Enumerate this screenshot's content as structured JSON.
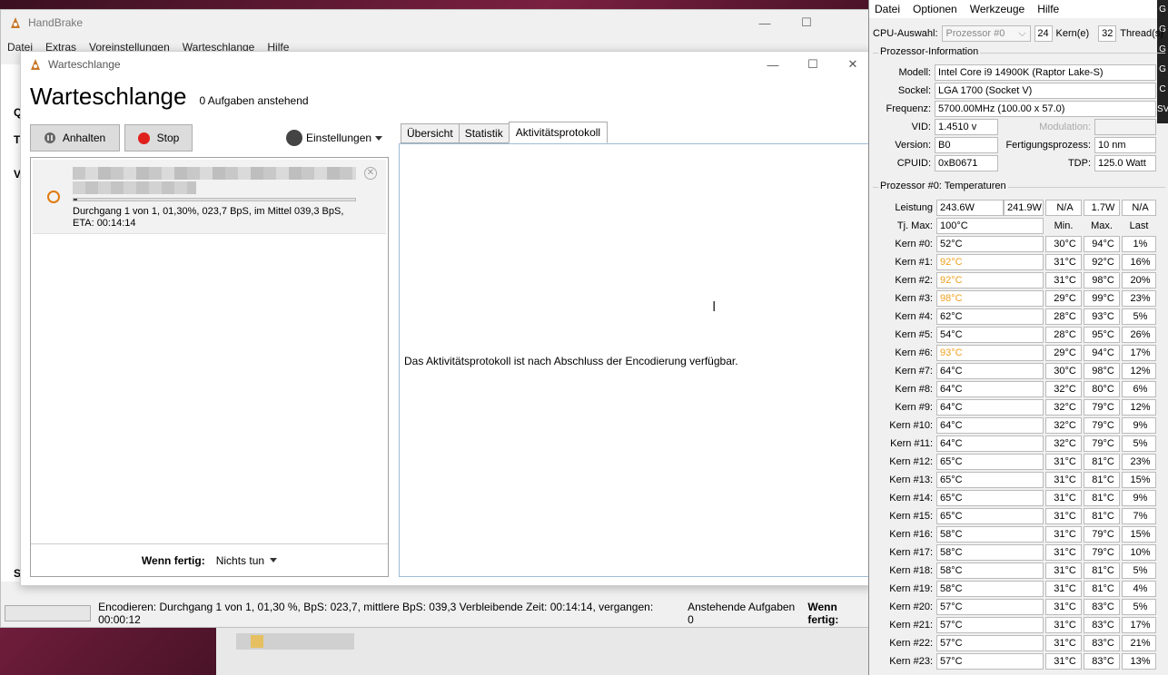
{
  "hb": {
    "title": "HandBrake",
    "menu": [
      "Datei",
      "Extras",
      "Voreinstellungen",
      "Warteschlange",
      "Hilfe"
    ],
    "side_letters": [
      "Q",
      "T",
      "V",
      "S"
    ],
    "status": {
      "encoding": "Encodieren: Durchgang 1 von 1, 01,30 %, BpS: 023,7, mittlere BpS: 039,3 Verbleibende Zeit: 00:14:14, vergangen: 00:00:12",
      "pending": "Anstehende Aufgaben 0",
      "when_done": "Wenn fertig:"
    }
  },
  "queue": {
    "window_title": "Warteschlange",
    "heading": "Warteschlange",
    "pending_count": "0 Aufgaben anstehend",
    "pause_label": "Anhalten",
    "stop_label": "Stop",
    "settings_label": "Einstellungen",
    "job": {
      "progress_fraction": 0.013,
      "line1": "Durchgang 1 von 1, 01,30%, 023,7 BpS, im Mittel 039,3 BpS,",
      "line2": "ETA: 00:14:14"
    },
    "when_done_label": "Wenn fertig:",
    "when_done_value": "Nichts tun",
    "tabs": [
      "Übersicht",
      "Statistik",
      "Aktivitätsprotokoll"
    ],
    "active_tab": 2,
    "log_message": "Das Aktivitätsprotokoll ist nach Abschluss der Encodierung verfügbar."
  },
  "sensor": {
    "menu": [
      "Datei",
      "Optionen",
      "Werkzeuge",
      "Hilfe"
    ],
    "edge_letters": [
      "G",
      "G",
      "G",
      "G",
      "C",
      "SV"
    ],
    "cpu_select_label": "CPU-Auswahl:",
    "cpu_select_value": "Prozessor #0",
    "cores_value": "24",
    "cores_label": "Kern(e)",
    "threads_value": "32",
    "threads_label": "Thread(s)",
    "info_title": "Prozessor-Information",
    "model_label": "Modell:",
    "model": "Intel Core i9 14900K (Raptor Lake-S)",
    "socket_label": "Sockel:",
    "socket": "LGA 1700 (Socket V)",
    "freq_label": "Frequenz:",
    "freq": "5700.00MHz (100.00 x 57.0)",
    "vid_label": "VID:",
    "vid": "1.4510 v",
    "modulation_label": "Modulation:",
    "version_label": "Version:",
    "version": "B0",
    "process_label": "Fertigungsprozess:",
    "process": "10 nm",
    "cpuid_label": "CPUID:",
    "cpuid": "0xB0671",
    "tdp_label": "TDP:",
    "tdp": "125.0 Watt",
    "temps_title": "Prozessor #0: Temperaturen",
    "power_label": "Leistung",
    "power": [
      "243.6W",
      "241.9W",
      "N/A",
      "1.7W",
      "N/A"
    ],
    "tjmax_label": "Tj. Max:",
    "tjmax": "100°C",
    "col_min": "Min.",
    "col_max": "Max.",
    "col_last": "Last",
    "cores": [
      {
        "name": "Kern #0:",
        "temp": "52°C",
        "min": "30°C",
        "max": "94°C",
        "load": "1%",
        "hot": false
      },
      {
        "name": "Kern #1:",
        "temp": "92°C",
        "min": "31°C",
        "max": "92°C",
        "load": "16%",
        "hot": true
      },
      {
        "name": "Kern #2:",
        "temp": "92°C",
        "min": "31°C",
        "max": "98°C",
        "load": "20%",
        "hot": true
      },
      {
        "name": "Kern #3:",
        "temp": "98°C",
        "min": "29°C",
        "max": "99°C",
        "load": "23%",
        "hot": true
      },
      {
        "name": "Kern #4:",
        "temp": "62°C",
        "min": "28°C",
        "max": "93°C",
        "load": "5%",
        "hot": false
      },
      {
        "name": "Kern #5:",
        "temp": "54°C",
        "min": "28°C",
        "max": "95°C",
        "load": "26%",
        "hot": false
      },
      {
        "name": "Kern #6:",
        "temp": "93°C",
        "min": "29°C",
        "max": "94°C",
        "load": "17%",
        "hot": true
      },
      {
        "name": "Kern #7:",
        "temp": "64°C",
        "min": "30°C",
        "max": "98°C",
        "load": "12%",
        "hot": false
      },
      {
        "name": "Kern #8:",
        "temp": "64°C",
        "min": "32°C",
        "max": "80°C",
        "load": "6%",
        "hot": false
      },
      {
        "name": "Kern #9:",
        "temp": "64°C",
        "min": "32°C",
        "max": "79°C",
        "load": "12%",
        "hot": false
      },
      {
        "name": "Kern #10:",
        "temp": "64°C",
        "min": "32°C",
        "max": "79°C",
        "load": "9%",
        "hot": false
      },
      {
        "name": "Kern #11:",
        "temp": "64°C",
        "min": "32°C",
        "max": "79°C",
        "load": "5%",
        "hot": false
      },
      {
        "name": "Kern #12:",
        "temp": "65°C",
        "min": "31°C",
        "max": "81°C",
        "load": "23%",
        "hot": false
      },
      {
        "name": "Kern #13:",
        "temp": "65°C",
        "min": "31°C",
        "max": "81°C",
        "load": "15%",
        "hot": false
      },
      {
        "name": "Kern #14:",
        "temp": "65°C",
        "min": "31°C",
        "max": "81°C",
        "load": "9%",
        "hot": false
      },
      {
        "name": "Kern #15:",
        "temp": "65°C",
        "min": "31°C",
        "max": "81°C",
        "load": "7%",
        "hot": false
      },
      {
        "name": "Kern #16:",
        "temp": "58°C",
        "min": "31°C",
        "max": "79°C",
        "load": "15%",
        "hot": false
      },
      {
        "name": "Kern #17:",
        "temp": "58°C",
        "min": "31°C",
        "max": "79°C",
        "load": "10%",
        "hot": false
      },
      {
        "name": "Kern #18:",
        "temp": "58°C",
        "min": "31°C",
        "max": "81°C",
        "load": "5%",
        "hot": false
      },
      {
        "name": "Kern #19:",
        "temp": "58°C",
        "min": "31°C",
        "max": "81°C",
        "load": "4%",
        "hot": false
      },
      {
        "name": "Kern #20:",
        "temp": "57°C",
        "min": "31°C",
        "max": "83°C",
        "load": "5%",
        "hot": false
      },
      {
        "name": "Kern #21:",
        "temp": "57°C",
        "min": "31°C",
        "max": "83°C",
        "load": "17%",
        "hot": false
      },
      {
        "name": "Kern #22:",
        "temp": "57°C",
        "min": "31°C",
        "max": "83°C",
        "load": "21%",
        "hot": false
      },
      {
        "name": "Kern #23:",
        "temp": "57°C",
        "min": "31°C",
        "max": "83°C",
        "load": "13%",
        "hot": false
      }
    ],
    "hot_color": "#f0a020"
  }
}
